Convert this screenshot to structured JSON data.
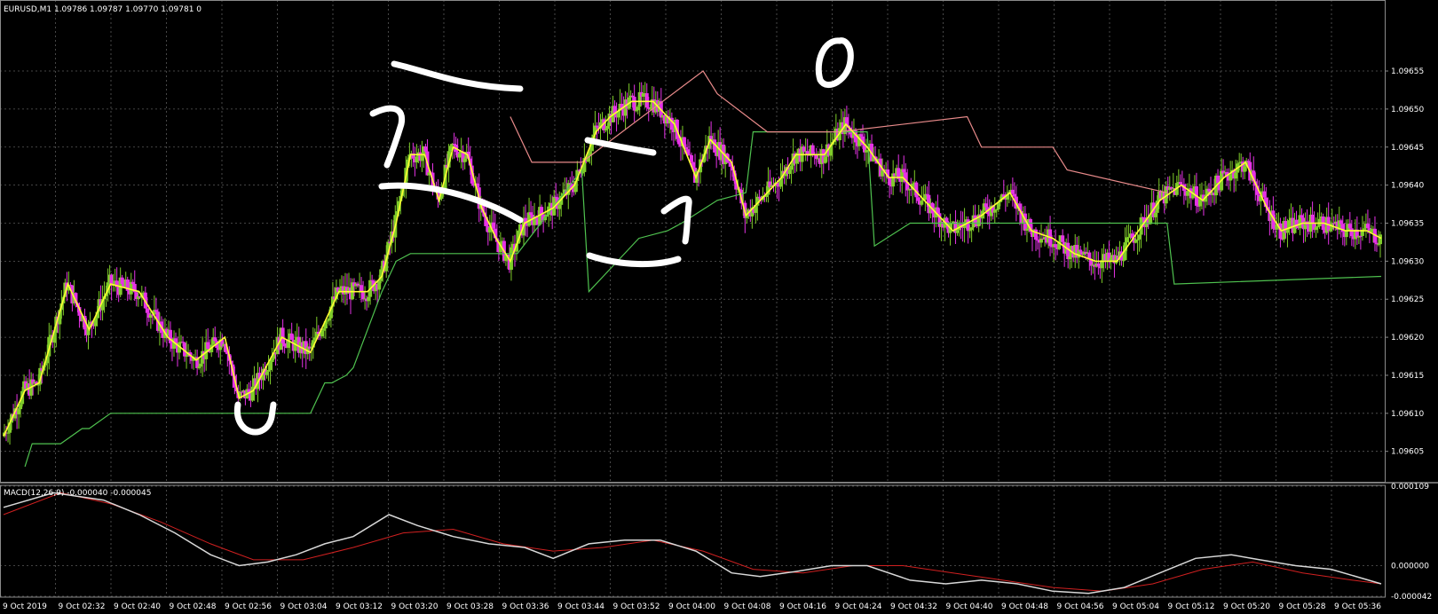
{
  "main_panel": {
    "header": "EURUSD,M1  1.09786 1.09787 1.09770 1.09781  0",
    "price_ticks": [
      "1.09655",
      "1.09650",
      "1.09645",
      "1.09640",
      "1.09635",
      "1.09630",
      "1.09625",
      "1.09620",
      "1.09615",
      "1.09610",
      "1.09605"
    ]
  },
  "macd_panel": {
    "header": "MACD(12,26,9) -0.000040 -0.000045",
    "ticks": [
      "0.000109",
      "0.000000",
      "-0.000042"
    ]
  },
  "time_axis": {
    "labels": [
      "9 Oct 2019",
      "9 Oct 02:32",
      "9 Oct 02:40",
      "9 Oct 02:48",
      "9 Oct 02:56",
      "9 Oct 03:04",
      "9 Oct 03:12",
      "9 Oct 03:20",
      "9 Oct 03:28",
      "9 Oct 03:36",
      "9 Oct 03:44",
      "9 Oct 03:52",
      "9 Oct 04:00",
      "9 Oct 04:08",
      "9 Oct 04:16",
      "9 Oct 04:24",
      "9 Oct 04:32",
      "9 Oct 04:40",
      "9 Oct 04:48",
      "9 Oct 04:56",
      "9 Oct 05:04",
      "9 Oct 05:12",
      "9 Oct 05:20",
      "9 Oct 05:28",
      "9 Oct 05:36"
    ]
  },
  "colors": {
    "background": "#000000",
    "grid": "#5a5a5a",
    "bull_candle": "#7fcc2a",
    "bear_candle": "#e633e6",
    "ma_line": "#ffff33",
    "trail_lower": "#4fc24f",
    "trail_upper": "#e88a8a",
    "macd_main": "#d8d8d8",
    "macd_signal": "#d02020",
    "annotation": "#ffffff"
  },
  "chart_data": [
    {
      "type": "line",
      "symbol": "EURUSD",
      "timeframe": "M1",
      "ylim": [
        1.09601,
        1.09662
      ],
      "price_line": {
        "x": [
          "02:23",
          "02:26",
          "02:28",
          "02:32",
          "02:35",
          "02:38",
          "02:42",
          "02:46",
          "02:50",
          "02:54",
          "02:56",
          "02:58",
          "03:02",
          "03:06",
          "03:10",
          "03:14",
          "03:16",
          "03:18",
          "03:20",
          "03:22",
          "03:24",
          "03:26",
          "03:28",
          "03:30",
          "03:32",
          "03:34",
          "03:36",
          "03:38",
          "03:40",
          "03:43",
          "03:46",
          "03:48",
          "03:51",
          "03:54",
          "03:57",
          "04:00",
          "04:02",
          "04:05",
          "04:07",
          "04:09",
          "04:12",
          "04:14",
          "04:18",
          "04:21",
          "04:24",
          "04:27",
          "04:29",
          "04:32",
          "04:36",
          "04:40",
          "04:44",
          "04:47",
          "04:50",
          "04:53",
          "04:56",
          "04:59",
          "05:02",
          "05:05",
          "05:08",
          "05:11",
          "05:14",
          "05:17",
          "05:20",
          "05:22",
          "05:25",
          "05:28",
          "05:31",
          "05:34",
          "05:36"
        ],
        "y": [
          1.09607,
          1.09613,
          1.09614,
          1.09627,
          1.09621,
          1.09627,
          1.09626,
          1.0962,
          1.09617,
          1.0962,
          1.09612,
          1.09613,
          1.0962,
          1.09618,
          1.09626,
          1.09626,
          1.09628,
          1.09635,
          1.09644,
          1.09644,
          1.09638,
          1.09645,
          1.09644,
          1.09637,
          1.09633,
          1.0963,
          1.09635,
          1.09636,
          1.09637,
          1.0964,
          1.09647,
          1.09649,
          1.09651,
          1.09651,
          1.09648,
          1.09641,
          1.09646,
          1.09643,
          1.09636,
          1.09638,
          1.09641,
          1.09644,
          1.09644,
          1.09648,
          1.09645,
          1.09641,
          1.09641,
          1.09638,
          1.09634,
          1.09636,
          1.09639,
          1.09634,
          1.09633,
          1.09631,
          1.0963,
          1.0963,
          1.09634,
          1.09638,
          1.0964,
          1.09638,
          1.09641,
          1.09643,
          1.09637,
          1.09634,
          1.09635,
          1.09635,
          1.09634,
          1.09634,
          1.09633
        ]
      },
      "trailing_lower": {
        "x": [
          "02:26",
          "02:27",
          "02:30",
          "02:31",
          "02:34",
          "02:35",
          "02:38",
          "02:39",
          "02:49",
          "03:06",
          "03:07",
          "03:08",
          "03:09",
          "03:11",
          "03:12",
          "03:16",
          "03:18",
          "03:20",
          "03:23",
          "03:32",
          "03:35",
          "03:44",
          "03:45",
          "03:49",
          "03:52",
          "03:56",
          "03:58",
          "04:03",
          "04:07",
          "04:08",
          "04:19",
          "04:24",
          "04:25",
          "04:30",
          "04:33",
          "04:38",
          "05:06",
          "05:07",
          "05:36"
        ],
        "y": [
          1.09603,
          1.09606,
          1.09606,
          1.09606,
          1.09608,
          1.09608,
          1.0961,
          1.0961,
          1.0961,
          1.0961,
          1.09612,
          1.09614,
          1.09614,
          1.09615,
          1.09616,
          1.09626,
          1.0963,
          1.09631,
          1.09631,
          1.09631,
          1.09631,
          1.09642,
          1.09626,
          1.0963,
          1.09633,
          1.09634,
          1.09635,
          1.09638,
          1.09639,
          1.09647,
          1.09647,
          1.09647,
          1.09632,
          1.09635,
          1.09635,
          1.09635,
          1.09635,
          1.09627,
          1.09628
        ]
      },
      "trailing_upper": {
        "x": [
          "03:34",
          "03:37",
          "03:44",
          "04:01",
          "04:03",
          "04:10",
          "04:20",
          "04:38",
          "04:40",
          "04:45",
          "04:50",
          "04:52",
          "05:06"
        ],
        "y": [
          1.09649,
          1.09643,
          1.09643,
          1.09655,
          1.09652,
          1.09647,
          1.09647,
          1.09649,
          1.09645,
          1.09645,
          1.09645,
          1.09642,
          1.09639
        ]
      },
      "annotations": [
        "U",
        "1",
        "1",
        "0"
      ]
    },
    {
      "type": "line",
      "title": "MACD(12,26,9)",
      "ylim": [
        -4.2e-05,
        0.000109
      ],
      "series": [
        {
          "values_x": [
            "02:23",
            "02:30",
            "02:37",
            "02:42",
            "02:47",
            "02:52",
            "02:56",
            "03:00",
            "03:04",
            "03:08",
            "03:12",
            "03:17",
            "03:21",
            "03:26",
            "03:31",
            "03:36",
            "03:40",
            "03:45",
            "03:50",
            "03:55",
            "04:00",
            "04:05",
            "04:09",
            "04:14",
            "04:19",
            "04:24",
            "04:30",
            "04:35",
            "04:40",
            "04:45",
            "04:50",
            "04:55",
            "05:00",
            "05:05",
            "05:10",
            "05:15",
            "05:19",
            "05:24",
            "05:29",
            "05:36"
          ],
          "values": [
            8e-05,
            0.0001,
            9e-05,
            7e-05,
            4.5e-05,
            1.5e-05,
            0.0,
            5e-06,
            1.5e-05,
            3e-05,
            4e-05,
            7e-05,
            5.5e-05,
            4e-05,
            3e-05,
            2.5e-05,
            1e-05,
            3e-05,
            3.5e-05,
            3.5e-05,
            2e-05,
            -1e-05,
            -1.5e-05,
            -8e-06,
            0.0,
            0.0,
            -2e-05,
            -2.5e-05,
            -2e-05,
            -2.5e-05,
            -3.5e-05,
            -3.8e-05,
            -3e-05,
            -1e-05,
            1e-05,
            1.5e-05,
            8e-06,
            0.0,
            -5e-06,
            -2.5e-05
          ]
        },
        {
          "values_x": [
            "02:23",
            "02:31",
            "02:38",
            "02:45",
            "02:52",
            "02:58",
            "03:05",
            "03:12",
            "03:19",
            "03:26",
            "03:33",
            "03:40",
            "03:47",
            "03:54",
            "04:01",
            "04:08",
            "04:15",
            "04:22",
            "04:29",
            "04:36",
            "04:43",
            "04:50",
            "04:57",
            "05:04",
            "05:11",
            "05:18",
            "05:25",
            "05:32",
            "05:36"
          ],
          "values": [
            7e-05,
            0.0001,
            8.5e-05,
            6e-05,
            3e-05,
            8e-06,
            8e-06,
            2.5e-05,
            4.5e-05,
            5e-05,
            3e-05,
            2e-05,
            2.5e-05,
            3.5e-05,
            2e-05,
            -5e-06,
            -1e-05,
            0.0,
            0.0,
            -1e-05,
            -2e-05,
            -3e-05,
            -3.5e-05,
            -2.5e-05,
            -5e-06,
            5e-06,
            -1e-05,
            -2e-05,
            -2.5e-05
          ]
        }
      ]
    }
  ]
}
